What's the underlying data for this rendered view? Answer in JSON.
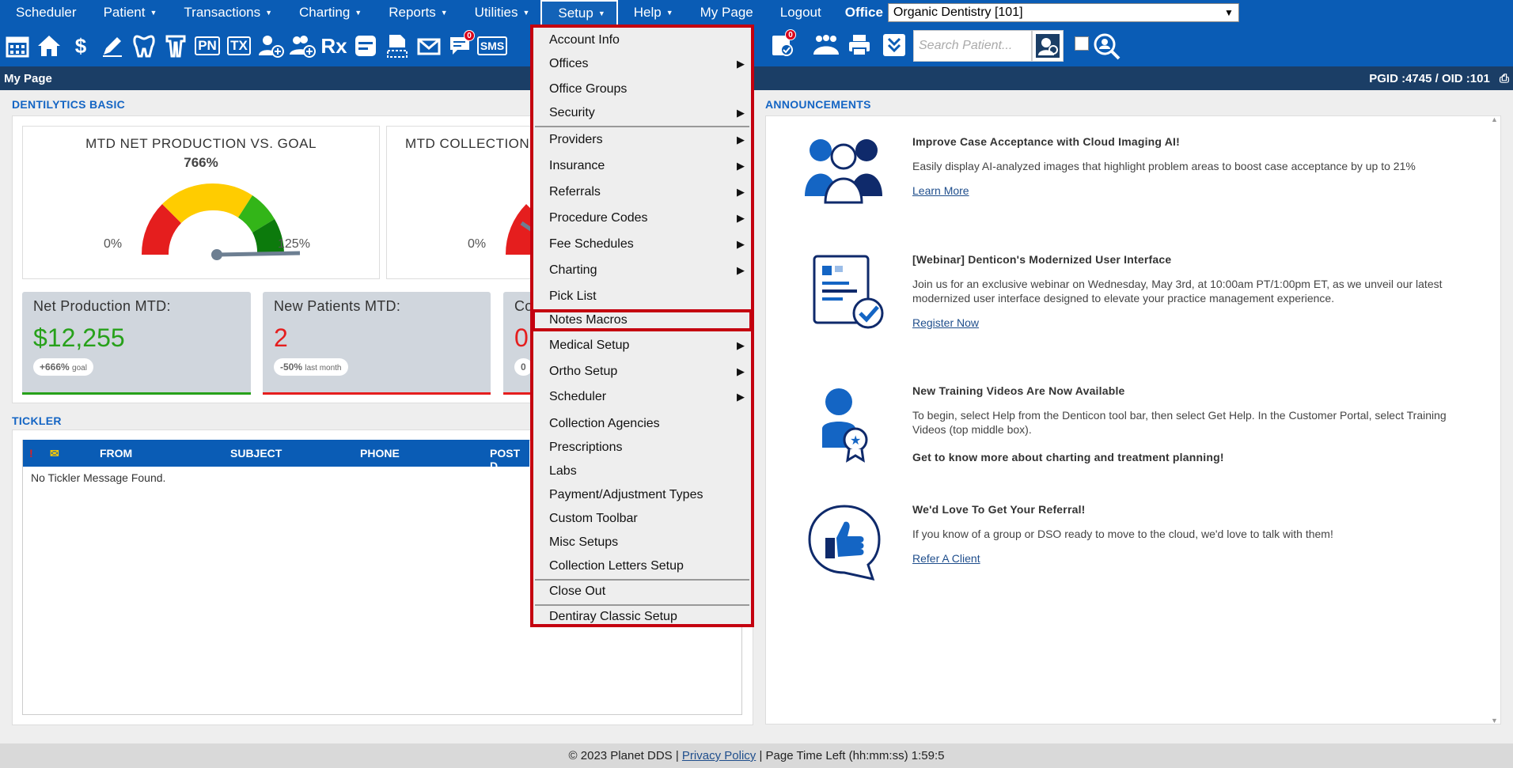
{
  "topnav": {
    "items": [
      {
        "label": "Scheduler",
        "caret": false
      },
      {
        "label": "Patient",
        "caret": true
      },
      {
        "label": "Transactions",
        "caret": true
      },
      {
        "label": "Charting",
        "caret": true
      },
      {
        "label": "Reports",
        "caret": true
      },
      {
        "label": "Utilities",
        "caret": true
      },
      {
        "label": "Setup",
        "caret": true,
        "active": true
      },
      {
        "label": "Help",
        "caret": true
      },
      {
        "label": "My Page",
        "caret": false
      },
      {
        "label": "Logout",
        "caret": false
      }
    ],
    "office_label": "Office",
    "office_value": "Organic Dentistry [101]"
  },
  "toolbar": {
    "icons": [
      "calendar-icon",
      "home-icon",
      "dollar-icon",
      "pen-icon",
      "tooth-icon",
      "tooth-roots-icon",
      "pn-icon",
      "tx-icon",
      "add-patient-icon",
      "add-family-icon",
      "rx-icon",
      "notes-icon",
      "document-icon",
      "envelope-icon",
      "messages-icon",
      "sms-icon",
      "clipboard-list-icon",
      "family-icon",
      "printer-icon",
      "chevron-down-icon"
    ],
    "pn_label": "PN",
    "tx_label": "TX",
    "rx_label": "Rx",
    "sms_label": "SMS",
    "messages_badge": "0",
    "clipboard_badge": "0",
    "search_placeholder": "Search Patient..."
  },
  "pagebar": {
    "title": "My Page",
    "ids": "PGID :4745  /  OID :101"
  },
  "dentilytics": {
    "section_title": "DENTILYTICS BASIC",
    "gauge1": {
      "title": "MTD NET PRODUCTION VS. GOAL",
      "pct": "766%",
      "min": "0%",
      "max": "125%"
    },
    "gauge2": {
      "title": "MTD COLLECTION",
      "min": "0%"
    },
    "stats": [
      {
        "label": "Net Production MTD:",
        "value": "$12,255",
        "pill_bold": "+666%",
        "pill_small": "goal",
        "color": "#27a11a"
      },
      {
        "label": "New Patients MTD:",
        "value": "2",
        "pill_bold": "-50%",
        "pill_small": "last month",
        "color": "#e51e1e"
      },
      {
        "label": "Co",
        "value": "0",
        "pill_bold": "0",
        "pill_small": "",
        "color": "#e51e1e"
      }
    ]
  },
  "tickler": {
    "section_title": "TICKLER",
    "cols": [
      "!",
      "FROM",
      "SUBJECT",
      "PHONE",
      "POST D"
    ],
    "empty": "No Tickler Message Found."
  },
  "announcements": {
    "section_title": "ANNOUNCEMENTS",
    "items": [
      {
        "title": "Improve Case Acceptance with Cloud Imaging AI!",
        "body": "Easily display AI-analyzed images that highlight problem areas to boost case acceptance by up to 21%",
        "link": "Learn More"
      },
      {
        "title": "[Webinar] Denticon's Modernized User Interface",
        "body": "Join us for an exclusive webinar on Wednesday, May 3rd, at 10:00am PT/1:00pm ET, as we unveil our latest modernized user interface designed to elevate your practice management experience.",
        "link": "Register Now"
      },
      {
        "title": "New Training Videos Are Now Available",
        "body": "To begin, select Help from the Denticon tool bar, then select Get Help. In the Customer Portal, select Training Videos (top middle box).",
        "extra": "Get to know more about charting and treatment planning!"
      },
      {
        "title": "We'd Love To Get Your Referral!",
        "body": "If you know of a group or DSO ready to move to the cloud, we'd love to talk with them!",
        "link": "Refer A Client"
      }
    ]
  },
  "setup_menu": {
    "items": [
      {
        "label": "Account Info",
        "sub": false
      },
      {
        "label": "Offices",
        "sub": true
      },
      {
        "label": "Office Groups",
        "sub": false
      },
      {
        "label": "Security",
        "sub": true
      },
      {
        "label": "Providers",
        "sub": true
      },
      {
        "label": "Insurance",
        "sub": true
      },
      {
        "label": "Referrals",
        "sub": true
      },
      {
        "label": "Procedure Codes",
        "sub": true
      },
      {
        "label": "Fee Schedules",
        "sub": true
      },
      {
        "label": "Charting",
        "sub": true
      },
      {
        "label": "Pick List",
        "sub": false
      },
      {
        "label": "Notes Macros",
        "sub": false,
        "highlighted": true
      },
      {
        "label": "Medical Setup",
        "sub": true
      },
      {
        "label": "Ortho Setup",
        "sub": true
      },
      {
        "label": "Scheduler",
        "sub": true
      },
      {
        "label": "Collection Agencies",
        "sub": false
      },
      {
        "label": "Prescriptions",
        "sub": false
      },
      {
        "label": "Labs",
        "sub": false
      },
      {
        "label": "Payment/Adjustment Types",
        "sub": false
      },
      {
        "label": "Custom Toolbar",
        "sub": false
      },
      {
        "label": "Misc Setups",
        "sub": false
      },
      {
        "label": "Collection Letters Setup",
        "sub": false
      },
      {
        "label": "Close Out",
        "sub": false
      },
      {
        "label": "Dentiray Classic Setup",
        "sub": false
      }
    ]
  },
  "footer": {
    "copyright": "© 2023 Planet DDS |",
    "privacy": "Privacy Policy",
    "time_left": "|  Page Time Left (hh:mm:ss) 1:59:5"
  },
  "colors": {
    "nav": "#0a5cb5",
    "pagebar": "#1b3e66",
    "highlight": "#c4000f",
    "accent": "#1465c4"
  }
}
